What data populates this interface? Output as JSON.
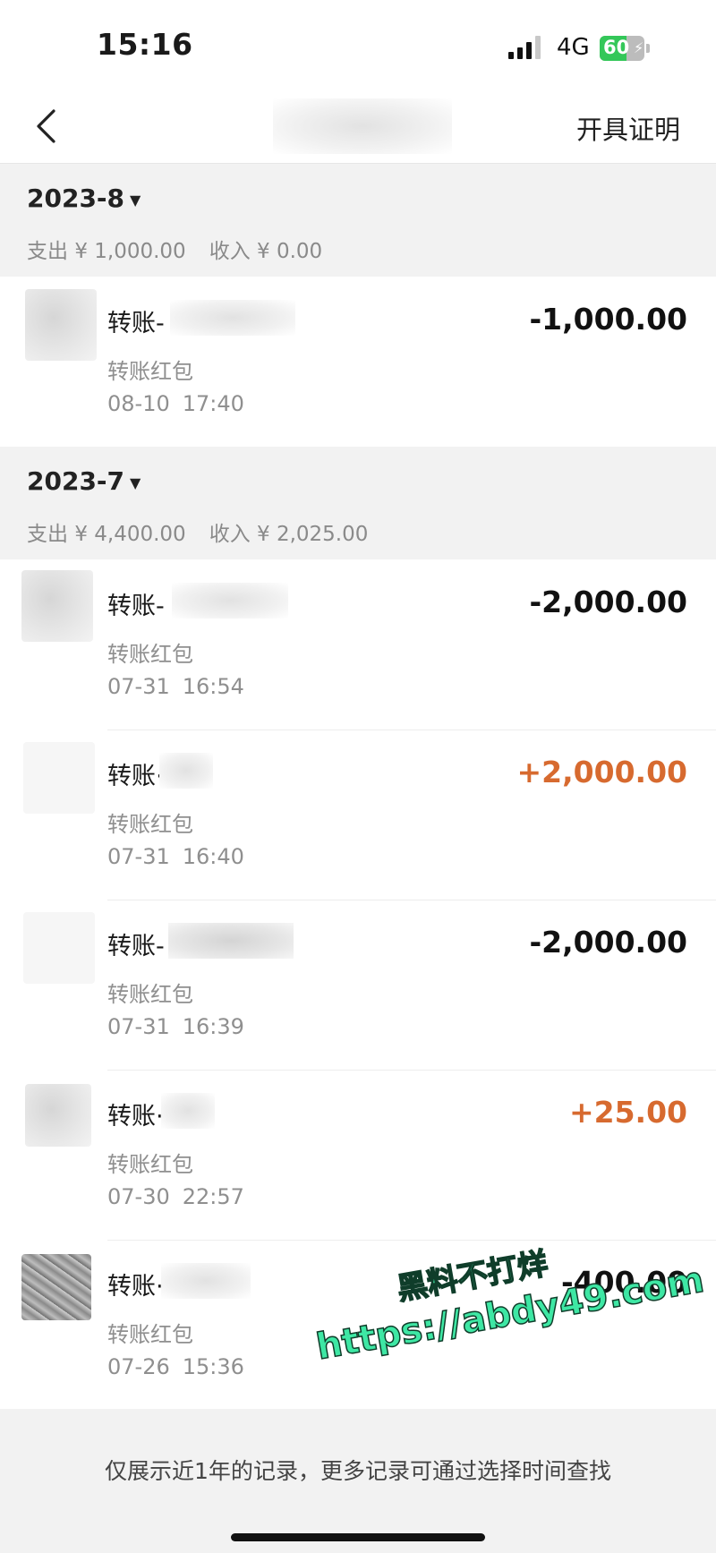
{
  "status_bar": {
    "time": "15:16",
    "network": "4G",
    "battery_level": "60",
    "battery_fraction": 0.6
  },
  "nav": {
    "certificate_label": "开具证明"
  },
  "months": [
    {
      "label": "2023-8",
      "expense_label": "支出",
      "expense_value": "¥ 1,000.00",
      "income_label": "收入",
      "income_value": "¥ 0.00",
      "transactions": [
        {
          "title": "转账-",
          "amount": "-1,000.00",
          "direction": "out",
          "category": "转账红包",
          "date": "08-10",
          "time": "17:40"
        }
      ]
    },
    {
      "label": "2023-7",
      "expense_label": "支出",
      "expense_value": "¥ 4,400.00",
      "income_label": "收入",
      "income_value": "¥ 2,025.00",
      "transactions": [
        {
          "title": "转账-",
          "amount": "-2,000.00",
          "direction": "out",
          "category": "转账红包",
          "date": "07-31",
          "time": "16:54"
        },
        {
          "title": "转账·",
          "amount": "+2,000.00",
          "direction": "in",
          "category": "转账红包",
          "date": "07-31",
          "time": "16:40"
        },
        {
          "title": "转账-",
          "amount": "-2,000.00",
          "direction": "out",
          "category": "转账红包",
          "date": "07-31",
          "time": "16:39"
        },
        {
          "title": "转账·",
          "amount": "+25.00",
          "direction": "in",
          "category": "转账红包",
          "date": "07-30",
          "time": "22:57"
        },
        {
          "title": "转账·",
          "amount": "-400.00",
          "direction": "out",
          "category": "转账红包",
          "date": "07-26",
          "time": "15:36"
        }
      ]
    }
  ],
  "footer": {
    "note": "仅展示近1年的记录，更多记录可通过选择时间查找"
  },
  "watermark": {
    "line1": "黑料不打烊",
    "line2": "https://abdy49.com"
  },
  "colors": {
    "income": "#d76a2f",
    "expense": "#111111",
    "section_bg": "#f2f2f2"
  }
}
